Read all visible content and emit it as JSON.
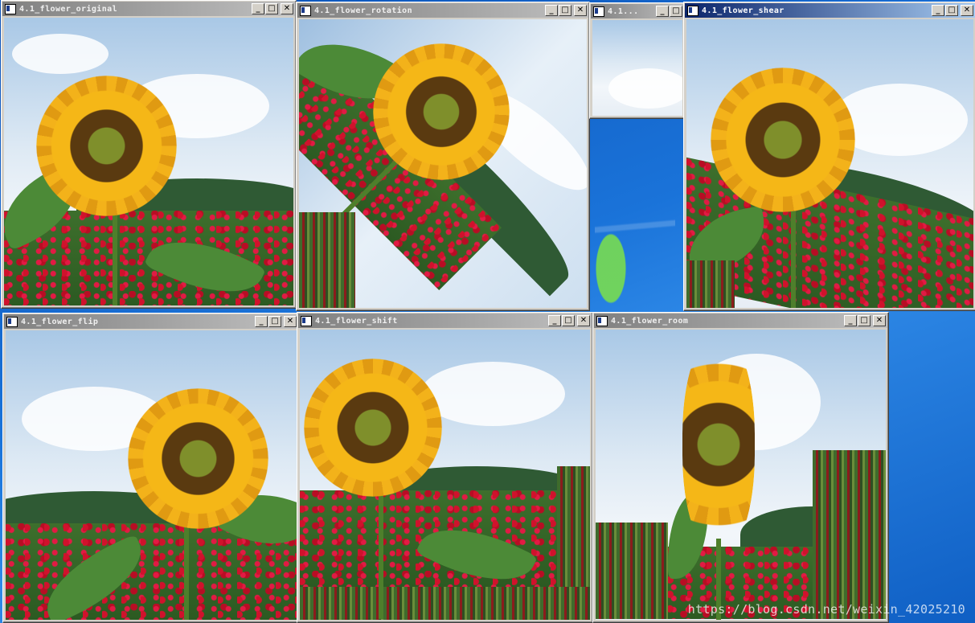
{
  "windows": [
    {
      "title": "4.1_flower_original"
    },
    {
      "title": "4.1_flower_rotation"
    },
    {
      "title": "4.1..."
    },
    {
      "title": "4.1_flower_shear"
    },
    {
      "title": "4.1_flower_flip"
    },
    {
      "title": "4.1_flower_shift"
    },
    {
      "title": "4.1_flower_room"
    }
  ],
  "controls": {
    "minimize": "_",
    "maximize": "□",
    "close": "✕"
  },
  "watermark": "https://blog.csdn.net/weixin_42025210"
}
